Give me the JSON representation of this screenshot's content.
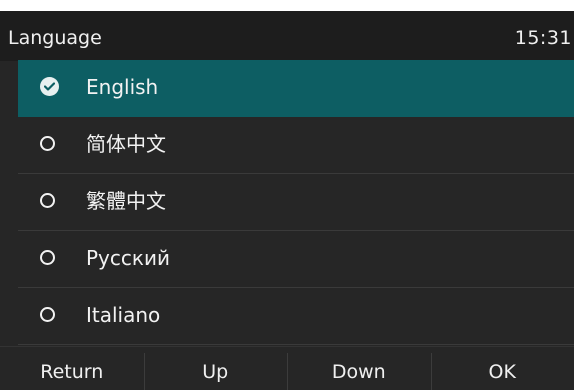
{
  "header": {
    "title": "Language",
    "time": "15:31"
  },
  "languages": [
    {
      "label": "English",
      "selected": true
    },
    {
      "label": "简体中文",
      "selected": false
    },
    {
      "label": "繁體中文",
      "selected": false
    },
    {
      "label": "Русский",
      "selected": false
    },
    {
      "label": "Italiano",
      "selected": false
    }
  ],
  "softkeys": {
    "return": "Return",
    "up": "Up",
    "down": "Down",
    "ok": "OK"
  },
  "colors": {
    "background": "#262626",
    "highlight": "#0d5e63",
    "text": "#f2f2f2"
  }
}
